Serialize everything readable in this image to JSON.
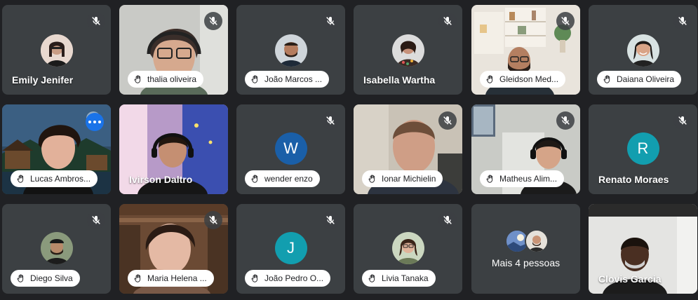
{
  "participants": {
    "emily": {
      "name": "Emily Jenifer"
    },
    "thalia": {
      "name": "thalia oliveira"
    },
    "joao_marcos": {
      "name": "João Marcos ..."
    },
    "isabella": {
      "name": "Isabella Wartha"
    },
    "gleidson": {
      "name": "Gleidson Med..."
    },
    "daiana": {
      "name": "Daiana Oliveira"
    },
    "lucas": {
      "name": "Lucas Ambros..."
    },
    "ivirson": {
      "name": "Ivirson Daltro"
    },
    "wender": {
      "name": "wender enzo",
      "initial": "W"
    },
    "ionar": {
      "name": "Ionar Michielin"
    },
    "matheus": {
      "name": "Matheus Alim..."
    },
    "renato": {
      "name": "Renato Moraes",
      "initial": "R"
    },
    "diego": {
      "name": "Diego Silva"
    },
    "maria": {
      "name": "Maria Helena ..."
    },
    "joao_pedro": {
      "name": "João Pedro O...",
      "initial": "J"
    },
    "livia": {
      "name": "Livia Tanaka"
    },
    "more": {
      "label": "Mais 4 pessoas"
    },
    "clovis": {
      "name": "Clovis Garcia"
    }
  },
  "colors": {
    "background": "#202124",
    "tile": "#3c4043",
    "active_border": "#8ab4f8",
    "wender_avatar": "#1a5fa8",
    "renato_avatar": "#129eaf",
    "joao_pedro_avatar": "#129eaf"
  },
  "icons": [
    "mic-off-icon",
    "hand-raised-icon",
    "more-options-icon"
  ]
}
